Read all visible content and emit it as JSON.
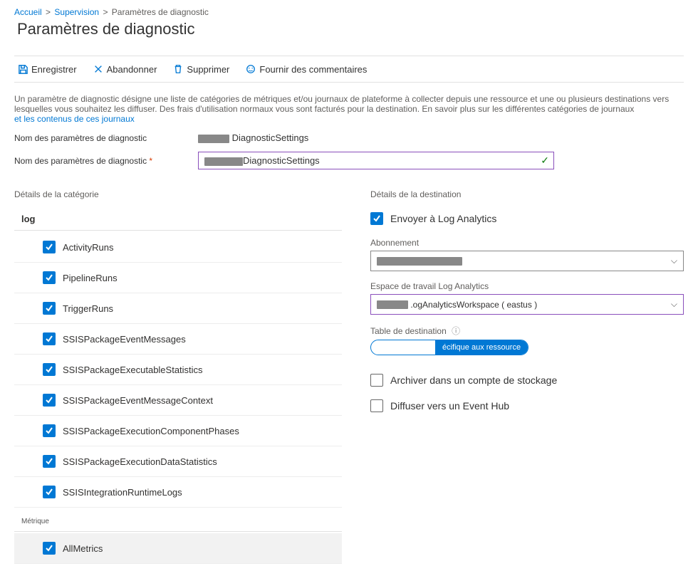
{
  "breadcrumb": {
    "home": "Accueil",
    "monitor": "Supervision",
    "current": "Paramètres de diagnostic"
  },
  "title": "Paramètres de diagnostic",
  "toolbar": {
    "save": "Enregistrer",
    "discard": "Abandonner",
    "delete": "Supprimer",
    "feedback": "Fournir des commentaires"
  },
  "description": {
    "line1": "Un paramètre de diagnostic désigne une liste de catégories de métriques et/ou journaux de plateforme à collecter depuis une ressource et une ou plusieurs destinations vers lesquelles vous souhaitez les diffuser. Des frais d'utilisation normaux vous sont facturés pour la destination. En savoir plus sur les différentes catégories de journaux ",
    "link": "et les contenus de ces journaux"
  },
  "fields": {
    "name_label": "Nom des paramètres de diagnostic",
    "name_display": "DiagnosticSettings",
    "name_editable_label": "Nom des paramètres de diagnostic",
    "name_editable_value": "DiagnosticSettings"
  },
  "category": {
    "header": "Détails de la catégorie",
    "group_log": "log",
    "items": [
      "ActivityRuns",
      "PipelineRuns",
      "TriggerRuns",
      "SSISPackageEventMessages",
      "SSISPackageExecutableStatistics",
      "SSISPackageEventMessageContext",
      "SSISPackageExecutionComponentPhases",
      "SSISPackageExecutionDataStatistics",
      "SSISIntegrationRuntimeLogs"
    ],
    "group_metric": "Métrique",
    "metric_items": [
      "AllMetrics"
    ]
  },
  "destination": {
    "header": "Détails de la destination",
    "send_la": "Envoyer à Log Analytics",
    "subscription_label": "Abonnement",
    "subscription_value": "",
    "workspace_label": "Espace de travail Log Analytics",
    "workspace_value": " .ogAnalyticsWorkspace ( eastus )",
    "table_label": "Table de destination",
    "toggle_left": "",
    "toggle_right": "écifique aux ressource",
    "archive_storage": "Archiver dans un compte de stockage",
    "stream_eventhub": "Diffuser vers un Event Hub"
  }
}
